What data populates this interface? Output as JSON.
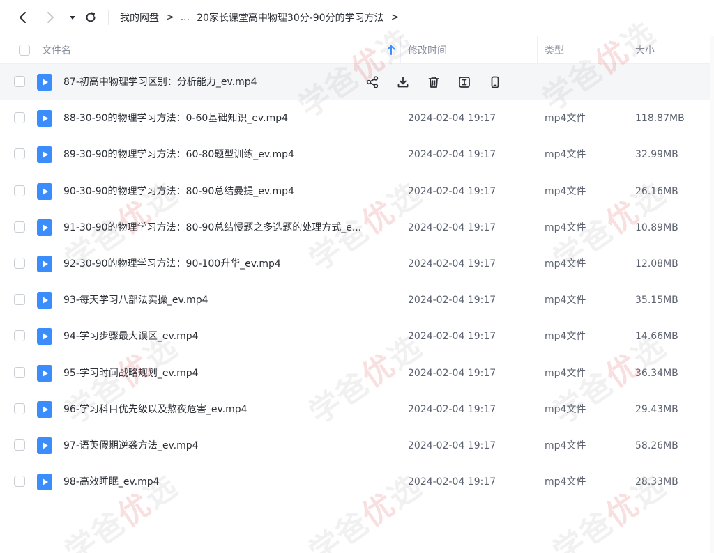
{
  "breadcrumb": {
    "root": "我的网盘",
    "sep": ">",
    "ellipsis": "...",
    "current": "20家长课堂高中物理30分-90分的学习方法",
    "tail": ">"
  },
  "header": {
    "name": "文件名",
    "modified": "修改时间",
    "type": "类型",
    "size": "大小"
  },
  "files": [
    {
      "name": "87-初高中物理学习区别：分析能力_ev.mp4",
      "date": "",
      "type": "",
      "size": ""
    },
    {
      "name": "88-30-90的物理学习方法：0-60基础知识_ev.mp4",
      "date": "2024-02-04 19:17",
      "type": "mp4文件",
      "size": "118.87MB"
    },
    {
      "name": "89-30-90的物理学习方法：60-80题型训练_ev.mp4",
      "date": "2024-02-04 19:17",
      "type": "mp4文件",
      "size": "32.99MB"
    },
    {
      "name": "90-30-90的物理学习方法：80-90总结曼提_ev.mp4",
      "date": "2024-02-04 19:17",
      "type": "mp4文件",
      "size": "26.16MB"
    },
    {
      "name": "91-30-90的物理学习方法：80-90总结慢题之多选题的处理方式_e...",
      "date": "2024-02-04 19:17",
      "type": "mp4文件",
      "size": "10.89MB"
    },
    {
      "name": "92-30-90的物理学习方法：90-100升华_ev.mp4",
      "date": "2024-02-04 19:17",
      "type": "mp4文件",
      "size": "12.08MB"
    },
    {
      "name": "93-每天学习八部法实操_ev.mp4",
      "date": "2024-02-04 19:17",
      "type": "mp4文件",
      "size": "35.15MB"
    },
    {
      "name": "94-学习步骤最大误区_ev.mp4",
      "date": "2024-02-04 19:17",
      "type": "mp4文件",
      "size": "14.66MB"
    },
    {
      "name": "95-学习时间战略规划_ev.mp4",
      "date": "2024-02-04 19:17",
      "type": "mp4文件",
      "size": "36.34MB"
    },
    {
      "name": "96-学习科目优先级以及熬夜危害_ev.mp4",
      "date": "2024-02-04 19:17",
      "type": "mp4文件",
      "size": "29.43MB"
    },
    {
      "name": "97-语英假期逆袭方法_ev.mp4",
      "date": "2024-02-04 19:17",
      "type": "mp4文件",
      "size": "58.26MB"
    },
    {
      "name": "98-高效睡眠_ev.mp4",
      "date": "2024-02-04 19:17",
      "type": "mp4文件",
      "size": "28.33MB"
    }
  ],
  "watermark": {
    "left": "学爸",
    "mid": "优",
    "right": "选"
  },
  "colors": {
    "accent": "#3a8dfb",
    "hover_row": "#f5f6f8",
    "text": "#2b2f36",
    "muted": "#878c9c"
  }
}
